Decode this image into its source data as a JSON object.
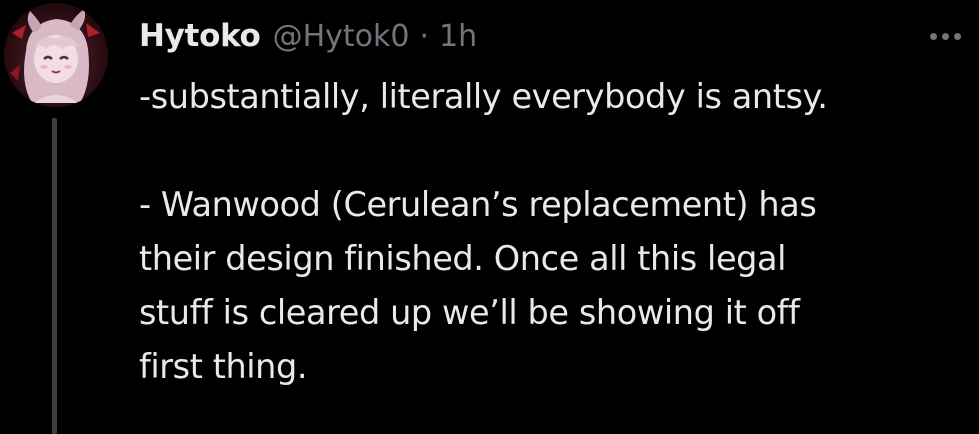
{
  "tweet": {
    "author": {
      "display_name": "Hytoko",
      "handle": "@Hytok0",
      "avatar": "avatar-image"
    },
    "separator": "·",
    "timestamp": "1h",
    "more_icon": "more-horizontal-icon",
    "lines": [
      "-substantially, literally everybody is antsy.",
      "",
      "- Wanwood (Cerulean’s replacement) has",
      "their design finished. Once all this legal",
      "stuff is cleared up we’ll be showing it off",
      "first thing."
    ]
  },
  "colors": {
    "background": "#000000",
    "primary_text": "#e7e9ea",
    "secondary_text": "#71767b",
    "thread_line": "#3b3f43"
  }
}
